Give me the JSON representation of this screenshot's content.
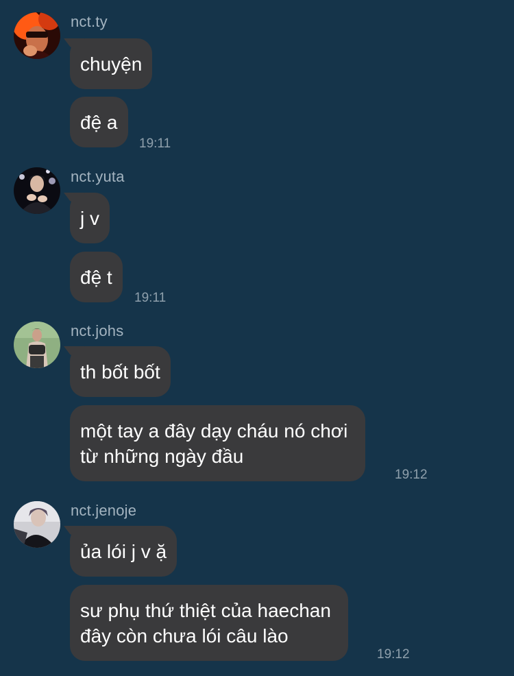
{
  "groups": [
    {
      "username": "nct.ty",
      "avatar": "avatar-photo-red-icon",
      "messages": [
        {
          "text": "chuyện",
          "time": ""
        },
        {
          "text": "đệ a",
          "time": "19:11"
        }
      ]
    },
    {
      "username": "nct.yuta",
      "avatar": "avatar-photo-dark-icon",
      "messages": [
        {
          "text": "j v",
          "time": ""
        },
        {
          "text": "đệ t",
          "time": "19:11"
        }
      ]
    },
    {
      "username": "nct.johs",
      "avatar": "avatar-photo-green-icon",
      "messages": [
        {
          "text": "th bốt bốt",
          "time": ""
        },
        {
          "text": "một tay a đây dạy cháu nó chơi\ntừ những ngày đầu",
          "time": "19:12"
        }
      ]
    },
    {
      "username": "nct.jenoje",
      "avatar": "avatar-photo-gray-icon",
      "messages": [
        {
          "text": "ủa lói j v ặ",
          "time": ""
        },
        {
          "text": "sư phụ thứ thiệt của haechan\nđây còn chưa lói câu lào",
          "time": "19:12"
        }
      ]
    }
  ]
}
